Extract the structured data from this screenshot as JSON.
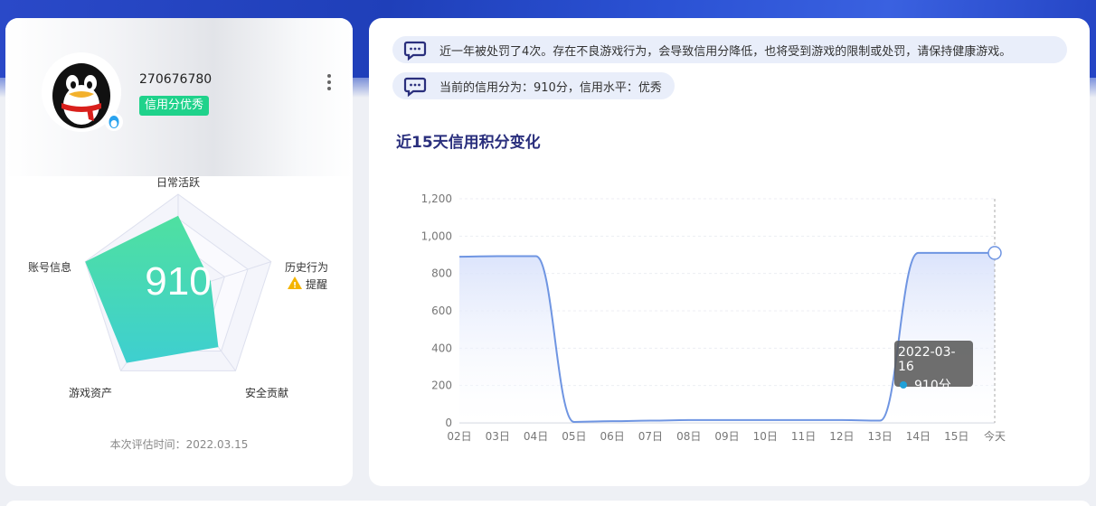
{
  "profile": {
    "uid": "270676780",
    "credit_badge": "信用分优秀",
    "avatar_icon": "qq-penguin-icon"
  },
  "radar": {
    "score": "910",
    "axes": [
      "日常活跃",
      "历史行为",
      "安全贡献",
      "游戏资产",
      "账号信息"
    ],
    "values": [
      0.78,
      0.35,
      0.7,
      0.9,
      1.0
    ],
    "warning_label": "提醒",
    "warning_icon": "warning-triangle-icon",
    "fill_color_top": "#4fe0a0",
    "fill_color_bottom": "#3ecfd0"
  },
  "eval_time": "本次评估时间：2022.03.15",
  "notices": {
    "penalty": "近一年被处罚了4次。存在不良游戏行为，会导致信用分降低，也将受到游戏的限制或处罚，请保持健康游戏。",
    "current": "当前的信用分为：910分，信用水平：优秀"
  },
  "chart_title": "近15天信用积分变化",
  "tooltip": {
    "date": "2022-03-16",
    "value": "910分"
  },
  "chart_data": {
    "type": "area",
    "x": [
      "02日",
      "03日",
      "04日",
      "05日",
      "06日",
      "07日",
      "08日",
      "09日",
      "10日",
      "11日",
      "12日",
      "13日",
      "14日",
      "15日",
      "今天"
    ],
    "ytick_labels": [
      "0",
      "200",
      "400",
      "600",
      "800",
      "1,000",
      "1,200"
    ],
    "series": [
      {
        "values": [
          890,
          893,
          893,
          5,
          9,
          12,
          15,
          15,
          15,
          15,
          15,
          12,
          910,
          910,
          910
        ]
      }
    ],
    "ylim": [
      0,
      1200
    ],
    "line_color": "#6f95e2",
    "area_color": "#dbe4fb",
    "grid": true
  }
}
